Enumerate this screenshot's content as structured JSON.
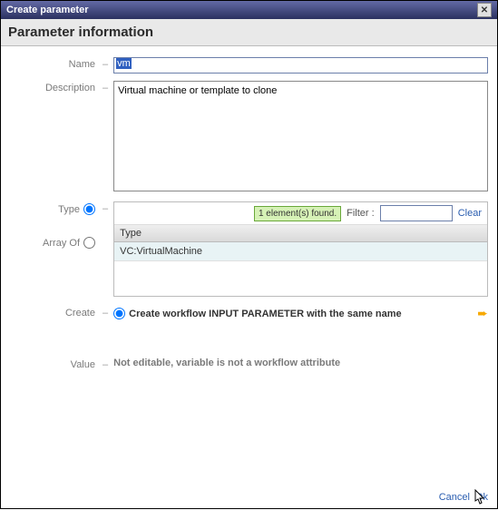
{
  "window": {
    "title": "Create parameter"
  },
  "header": {
    "title": "Parameter information"
  },
  "labels": {
    "name": "Name",
    "description": "Description",
    "type": "Type",
    "arrayOf": "Array Of",
    "create": "Create",
    "value": "Value"
  },
  "fields": {
    "name_value": "vm",
    "description_value": "Virtual machine or template to clone"
  },
  "typePanel": {
    "found_text": "1 element(s) found.",
    "filter_label": "Filter :",
    "filter_value": "",
    "clear_label": "Clear",
    "column_header": "Type",
    "rows": [
      "VC:VirtualMachine"
    ]
  },
  "createOption": {
    "label": "Create workflow INPUT PARAMETER with the same name"
  },
  "valueMsg": "Not editable, variable is not a workflow attribute",
  "footer": {
    "cancel": "Cancel",
    "ok": "Qk"
  }
}
